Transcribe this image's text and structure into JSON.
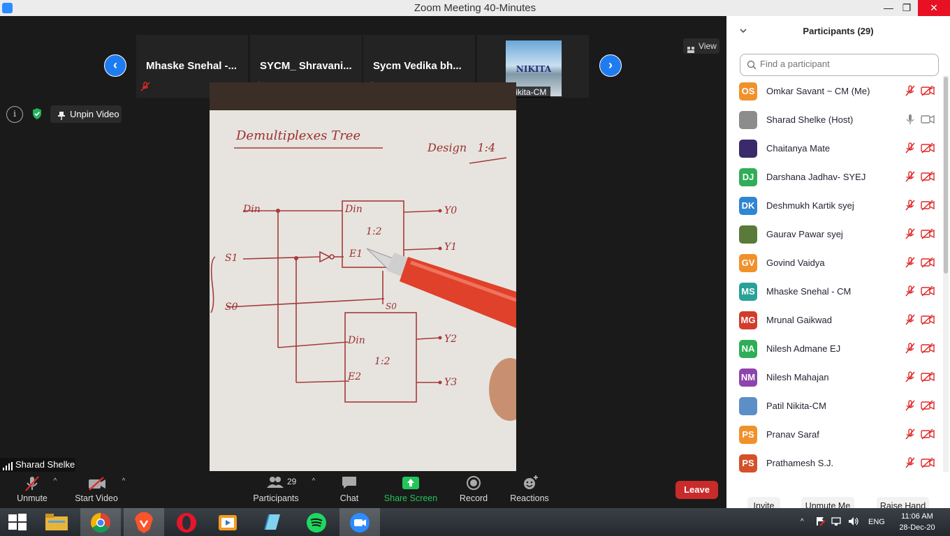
{
  "window": {
    "title": "Zoom Meeting 40-Minutes"
  },
  "thumbnails": [
    {
      "name": "Mhaske  Snehal  -..."
    },
    {
      "name": "SYCM_  Shravani..."
    },
    {
      "name": "Sycm  Vedika   bh..."
    },
    {
      "name": "Patil Nikita-CM",
      "logo_text": "NIKITA"
    }
  ],
  "controls": {
    "view_label": "View",
    "unpin_label": "Unpin Video"
  },
  "active_speaker": "Sharad Shelke",
  "shared_video": {
    "title": "Demultiplexes  Tree",
    "design": "Design   1:4",
    "labels": {
      "din": "Din",
      "s1": "S1",
      "s0": "S0",
      "top_din": "Din",
      "top_ratio": "1:2",
      "top_en": "E1",
      "bot_din": "Din",
      "bot_ratio": "1:2",
      "bot_en": "E2",
      "bot_s0": "S0",
      "y0": "Y0",
      "y1": "Y1",
      "y2": "Y2",
      "y3": "Y3"
    }
  },
  "toolbar": {
    "unmute": "Unmute",
    "start_video": "Start Video",
    "participants": "Participants",
    "participants_count": "29",
    "chat": "Chat",
    "share_screen": "Share Screen",
    "record": "Record",
    "reactions": "Reactions",
    "leave": "Leave"
  },
  "panel": {
    "title": "Participants (29)",
    "search_placeholder": "Find a participant",
    "participants": [
      {
        "initials": "OS",
        "name": "Omkar Savant ~ CM (Me)",
        "color": "#f0912c",
        "muted": true
      },
      {
        "initials": "",
        "name": "Sharad Shelke (Host)",
        "color": "#8c8c8c",
        "muted": false
      },
      {
        "initials": "",
        "name": "Chaitanya Mate",
        "color": "#3a2a6a",
        "muted": true
      },
      {
        "initials": "DJ",
        "name": "Darshana Jadhav- SYEJ",
        "color": "#2fae57",
        "muted": true
      },
      {
        "initials": "DK",
        "name": "Deshmukh Kartik syej",
        "color": "#2f86d3",
        "muted": true
      },
      {
        "initials": "",
        "name": "Gaurav Pawar syej",
        "color": "#5a7a3a",
        "muted": true
      },
      {
        "initials": "GV",
        "name": "Govind Vaidya",
        "color": "#f0912c",
        "muted": true
      },
      {
        "initials": "MS",
        "name": "Mhaske Snehal - CM",
        "color": "#2aa198",
        "muted": true
      },
      {
        "initials": "MG",
        "name": "Mrunal Gaikwad",
        "color": "#d23c2c",
        "muted": true
      },
      {
        "initials": "NA",
        "name": "Nilesh Admane EJ",
        "color": "#2fae57",
        "muted": true
      },
      {
        "initials": "NM",
        "name": "Nilesh Mahajan",
        "color": "#8e44ad",
        "muted": true
      },
      {
        "initials": "",
        "name": "Patil Nikita-CM",
        "color": "#5d8fc7",
        "muted": true
      },
      {
        "initials": "PS",
        "name": "Pranav Saraf",
        "color": "#f0912c",
        "muted": true
      },
      {
        "initials": "PS",
        "name": "Prathamesh S.J.",
        "color": "#d4512a",
        "muted": true
      }
    ],
    "invite": "Invite",
    "unmute_me": "Unmute Me",
    "raise_hand": "Raise Hand"
  },
  "taskbar": {
    "lang": "ENG",
    "time": "11:06 AM",
    "date": "28-Dec-20"
  }
}
